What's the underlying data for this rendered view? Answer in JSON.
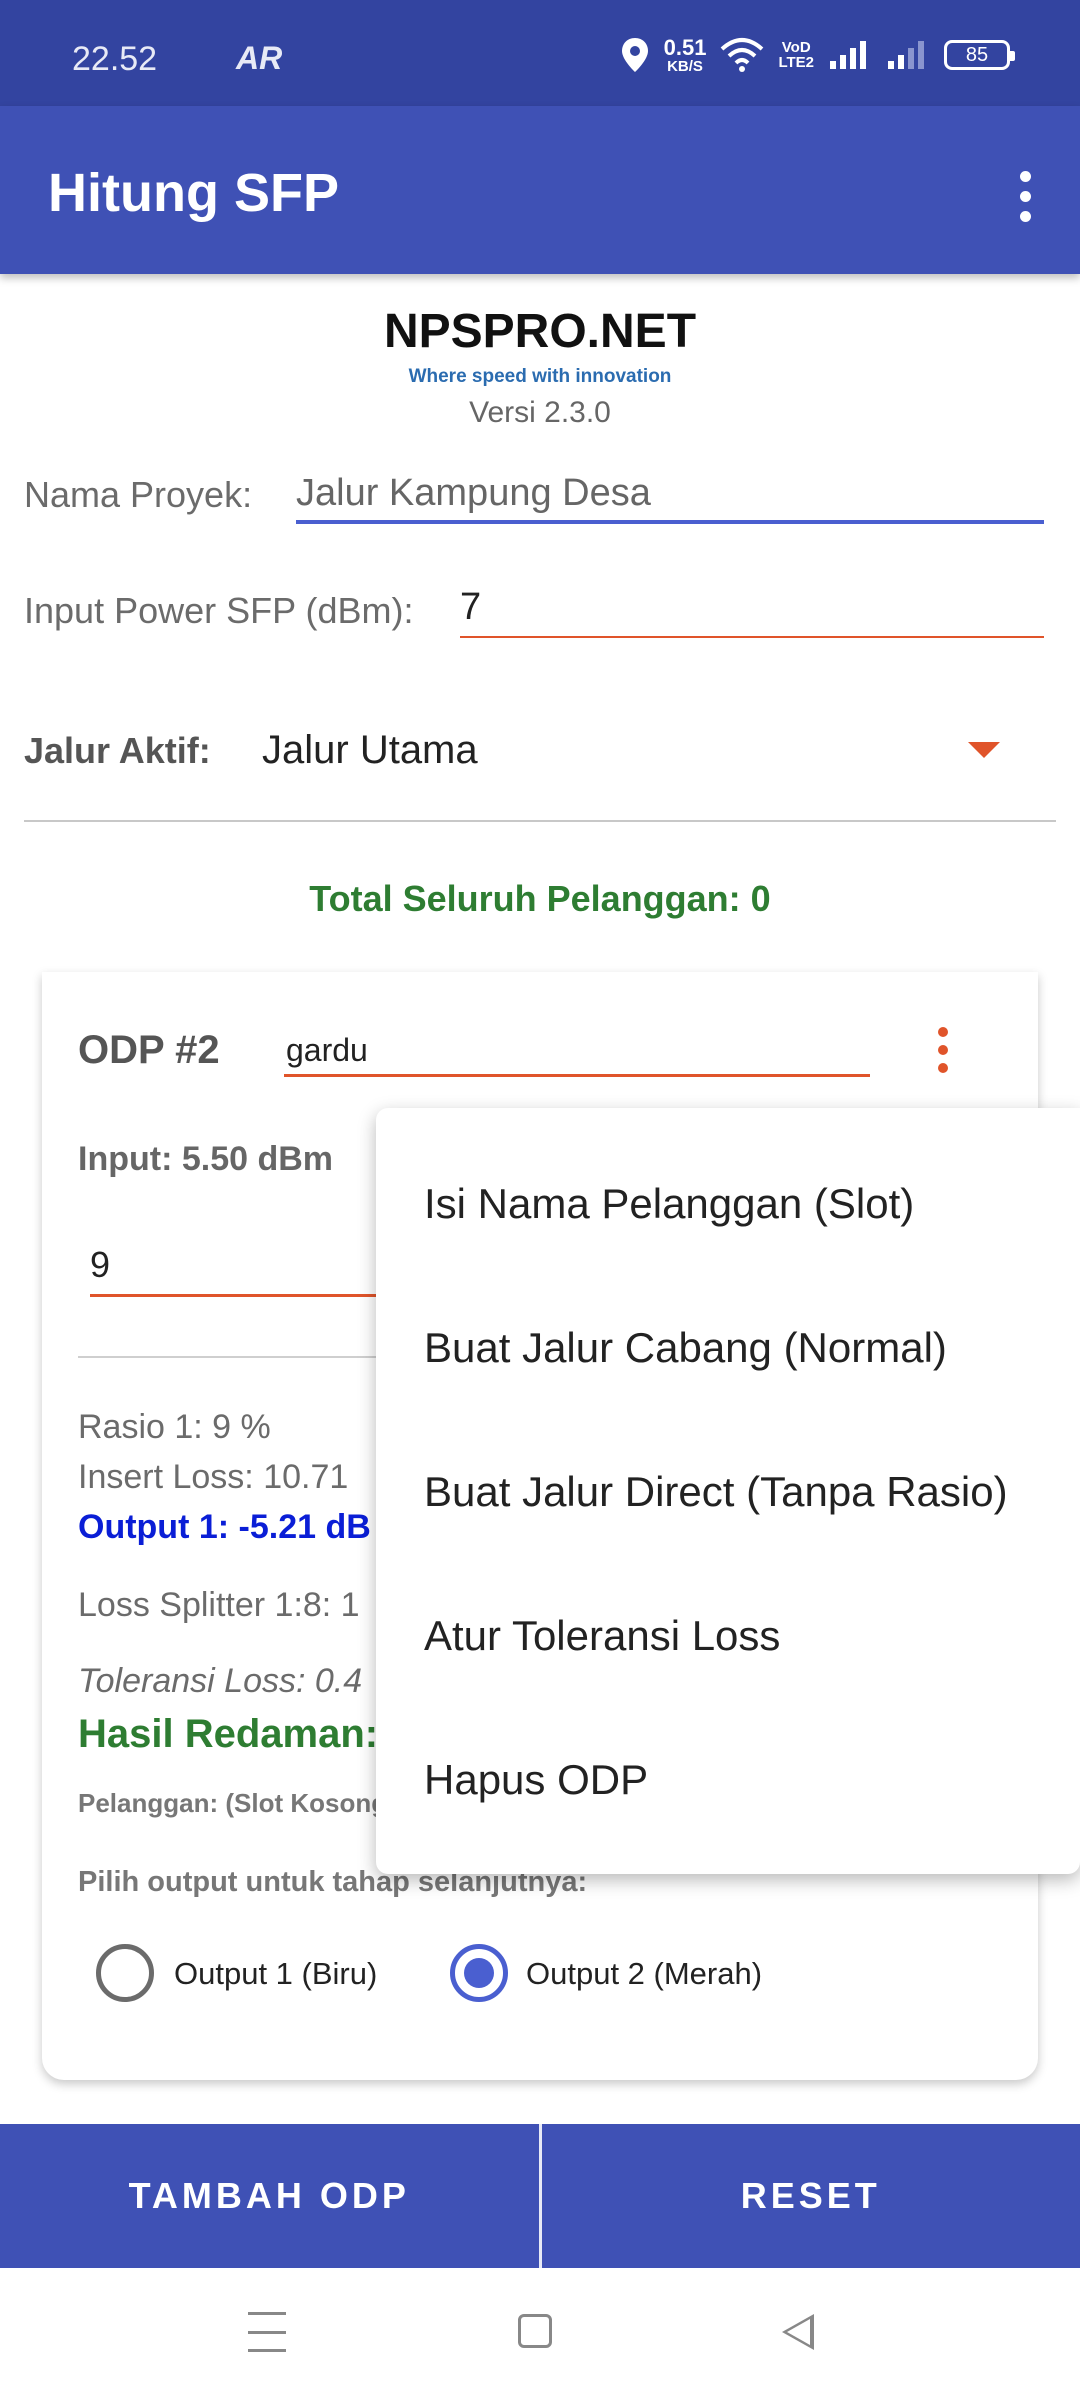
{
  "status_bar": {
    "time": "22.52",
    "ar_indicator": "AR",
    "net_speed": "0.51",
    "net_speed_unit": "KB/S",
    "volte_top": "VoD",
    "volte_bottom": "LTE2",
    "battery": "85",
    "icons": [
      "location-icon",
      "wifi-icon",
      "signal-icon",
      "signal-icon-2"
    ]
  },
  "app_bar": {
    "title": "Hitung SFP",
    "menu_icon": "overflow-menu-icon"
  },
  "branding": {
    "name": "NPSPRO.NET",
    "tagline": "Where speed with innovation",
    "version": "Versi 2.3.0"
  },
  "form": {
    "project_label": "Nama Proyek:",
    "project_value": "Jalur Kampung Desa",
    "sfp_label": "Input Power SFP (dBm):",
    "sfp_value": "7",
    "jalur_label": "Jalur Aktif:",
    "jalur_value": "Jalur Utama"
  },
  "total_customers": "Total Seluruh Pelanggan: 0",
  "odp": {
    "title": "ODP #2",
    "name": "gardu",
    "input": "Input: 5.50 dBm",
    "ratio_value": "9",
    "ratio_text": "Rasio 1: 9 %",
    "insert_loss": "Insert Loss: 10.71",
    "output1": "Output 1: -5.21 dB",
    "splitter_loss": "Loss Splitter 1:8: 1",
    "tolerance": "Toleransi Loss: 0.4",
    "result": "Hasil Redaman:",
    "customers": "Pelanggan: (Slot Kosong",
    "choose_output": "Pilih output untuk tahap selanjutnya:",
    "radio_options": [
      {
        "label": "Output 1 (Biru)",
        "selected": false
      },
      {
        "label": "Output 2 (Merah)",
        "selected": true
      }
    ]
  },
  "popup_menu": {
    "items": [
      "Isi Nama Pelanggan (Slot)",
      "Buat Jalur Cabang (Normal)",
      "Buat Jalur Direct (Tanpa Rasio)",
      "Atur Toleransi Loss",
      "Hapus ODP"
    ]
  },
  "bottom_buttons": {
    "add": "TAMBAH ODP",
    "reset": "RESET"
  },
  "colors": {
    "primary": "#3f51b5",
    "status_bar": "#3344a0",
    "accent": "#e0542a",
    "green": "#2e7d32",
    "blue_output": "#0a1ed6"
  }
}
